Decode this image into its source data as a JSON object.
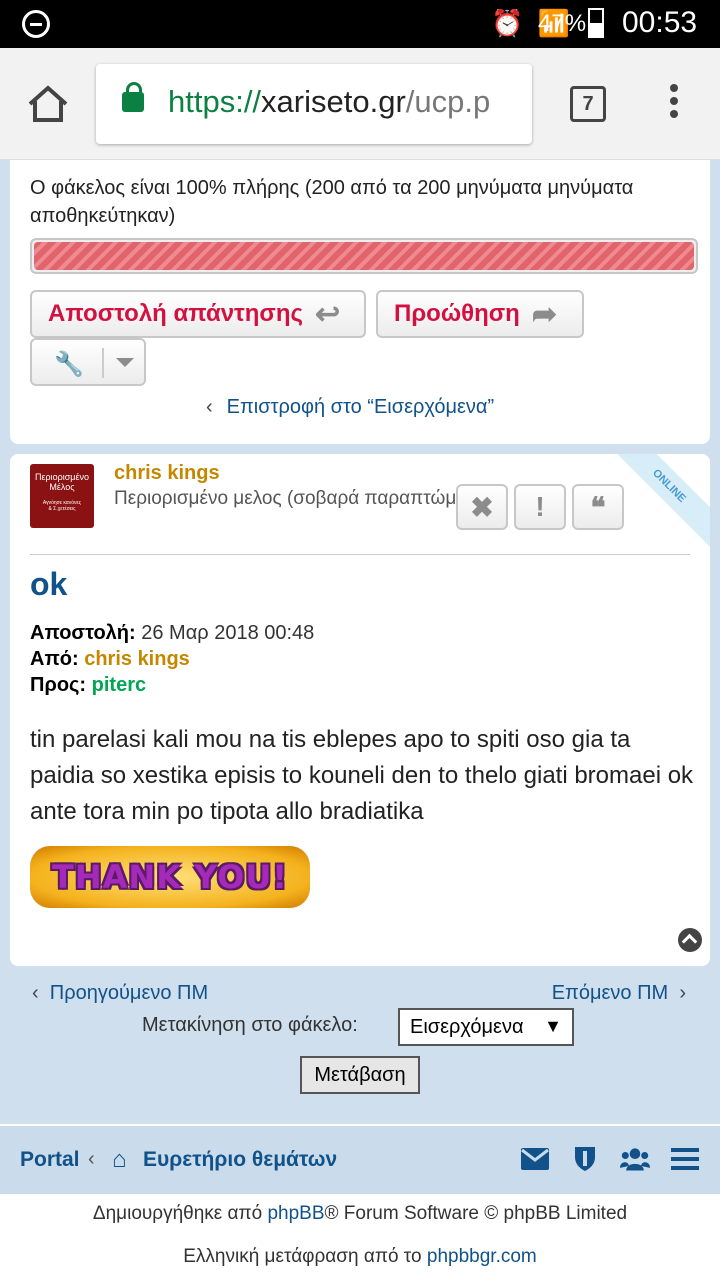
{
  "status_bar": {
    "battery": "47%",
    "time": "00:53"
  },
  "browser": {
    "url_scheme": "https://",
    "url_host": "xariseto.gr",
    "url_path": "/ucp.p",
    "tab_count": "7"
  },
  "folder": {
    "status_text": "Ο φάκελος είναι 100% πλήρης (200 από τα 200 μηνύματα μηνύματα αποθηκεύτηκαν)",
    "fill_percent": 100,
    "reply_label": "Αποστολή απάντησης",
    "forward_label": "Προώθηση",
    "back_link": "Επιστροφή στο “Εισερχόμενα”"
  },
  "post": {
    "online_label": "ONLINE",
    "avatar_line1": "Περιορισμένο",
    "avatar_line2": "Μέλος",
    "avatar_line3": "Αγνόησε κανόνες",
    "avatar_line4": "& Σ.χετέσεις",
    "author": "chris kings",
    "rank": "Περιορισμένο μελος (σοβαρά παραπτώματα)",
    "title": "ok",
    "date_label": "Αποστολή:",
    "date_value": "26 Μαρ 2018 00:48",
    "from_label": "Από:",
    "from_value": "chris kings",
    "to_label": "Προς:",
    "to_value": "piterc",
    "body": "tin parelasi kali mou na tis eblepes apo to spiti oso gia ta paidia so xestika episis to kouneli den to thelo giati bromaei ok ante tora min po tipota allo bradiatika",
    "image_text": "THANK YOU!"
  },
  "pagination": {
    "prev": "Προηγούμενο ΠΜ",
    "next": "Επόμενο ΠΜ",
    "move_label": "Μετακίνηση στο φάκελο:",
    "move_selected": "Εισερχόμενα",
    "go_button": "Μετάβαση"
  },
  "footer": {
    "portal": "Portal",
    "index": "Ευρετήριο θεμάτων",
    "line1_prefix": "Δημιουργήθηκε από ",
    "line1_link": "phpBB",
    "line1_suffix": "® Forum Software © phpBB Limited",
    "line2_prefix": "Ελληνική μετάφραση από το ",
    "line2_link": "phpbbgr.com"
  },
  "colors": {
    "link": "#105289",
    "accent": "#d31141",
    "author": "#c58700",
    "recipient": "#00a651",
    "progress": "#e1636b"
  },
  "icons": [
    "home-icon",
    "lock-icon",
    "tab-switcher-icon",
    "overflow-menu-icon",
    "reply-icon",
    "forward-icon",
    "wrench-icon",
    "delete-icon",
    "report-icon",
    "quote-icon",
    "back-to-top-icon",
    "envelope-icon",
    "shield-icon",
    "users-icon",
    "hamburger-icon"
  ]
}
